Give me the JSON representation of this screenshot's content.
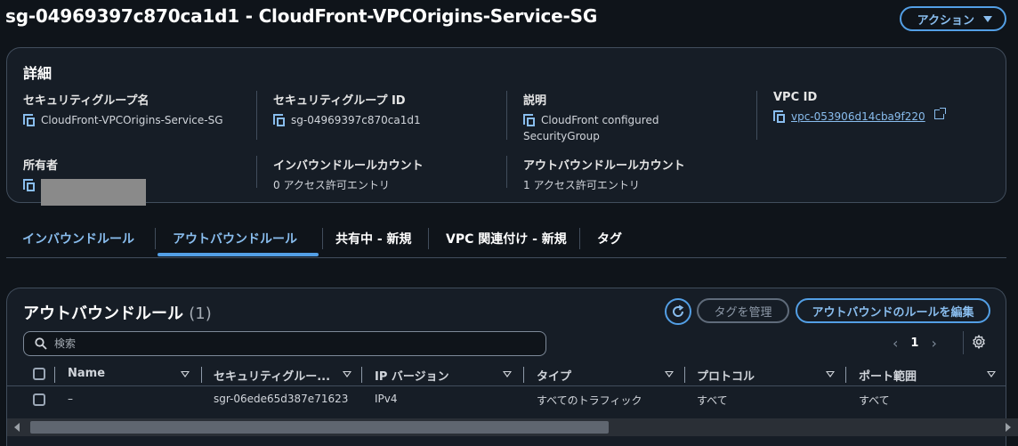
{
  "header": {
    "title": "sg-04969397c870ca1d1 - CloudFront-VPCOrigins-Service-SG",
    "actions_label": "アクション"
  },
  "details": {
    "heading": "詳細",
    "sg_name_label": "セキュリティグループ名",
    "sg_name_value": "CloudFront-VPCOrigins-Service-SG",
    "sg_id_label": "セキュリティグループ ID",
    "sg_id_value": "sg-04969397c870ca1d1",
    "description_label": "説明",
    "description_line1": "CloudFront configured",
    "description_line2": "SecurityGroup",
    "vpc_id_label": "VPC ID",
    "vpc_id_value": "vpc-053906d14cba9f220",
    "owner_label": "所有者",
    "inbound_count_label": "インバウンドルールカウント",
    "inbound_count_value": "0 アクセス許可エントリ",
    "outbound_count_label": "アウトバウンドルールカウント",
    "outbound_count_value": "1 アクセス許可エントリ"
  },
  "tabs": [
    {
      "label": "インバウンドルール"
    },
    {
      "label": "アウトバウンドルール"
    },
    {
      "label": "共有中 - 新規"
    },
    {
      "label": "VPC 関連付け - 新規"
    },
    {
      "label": "タグ"
    }
  ],
  "table_panel": {
    "title": "アウトバウンドルール",
    "count": "(1)",
    "manage_tags_label": "タグを管理",
    "edit_rules_label": "アウトバウンドのルールを編集",
    "search_placeholder": "検索",
    "page_number": "1",
    "columns": [
      "Name",
      "セキュリティグルー...",
      "IP バージョン",
      "タイプ",
      "プロトコル",
      "ポート範囲"
    ],
    "rows": [
      {
        "name": "–",
        "rule_id": "sgr-06ede65d387e71623",
        "ip_version": "IPv4",
        "type": "すべてのトラフィック",
        "protocol": "すべて",
        "port_range": "すべて"
      }
    ]
  }
}
